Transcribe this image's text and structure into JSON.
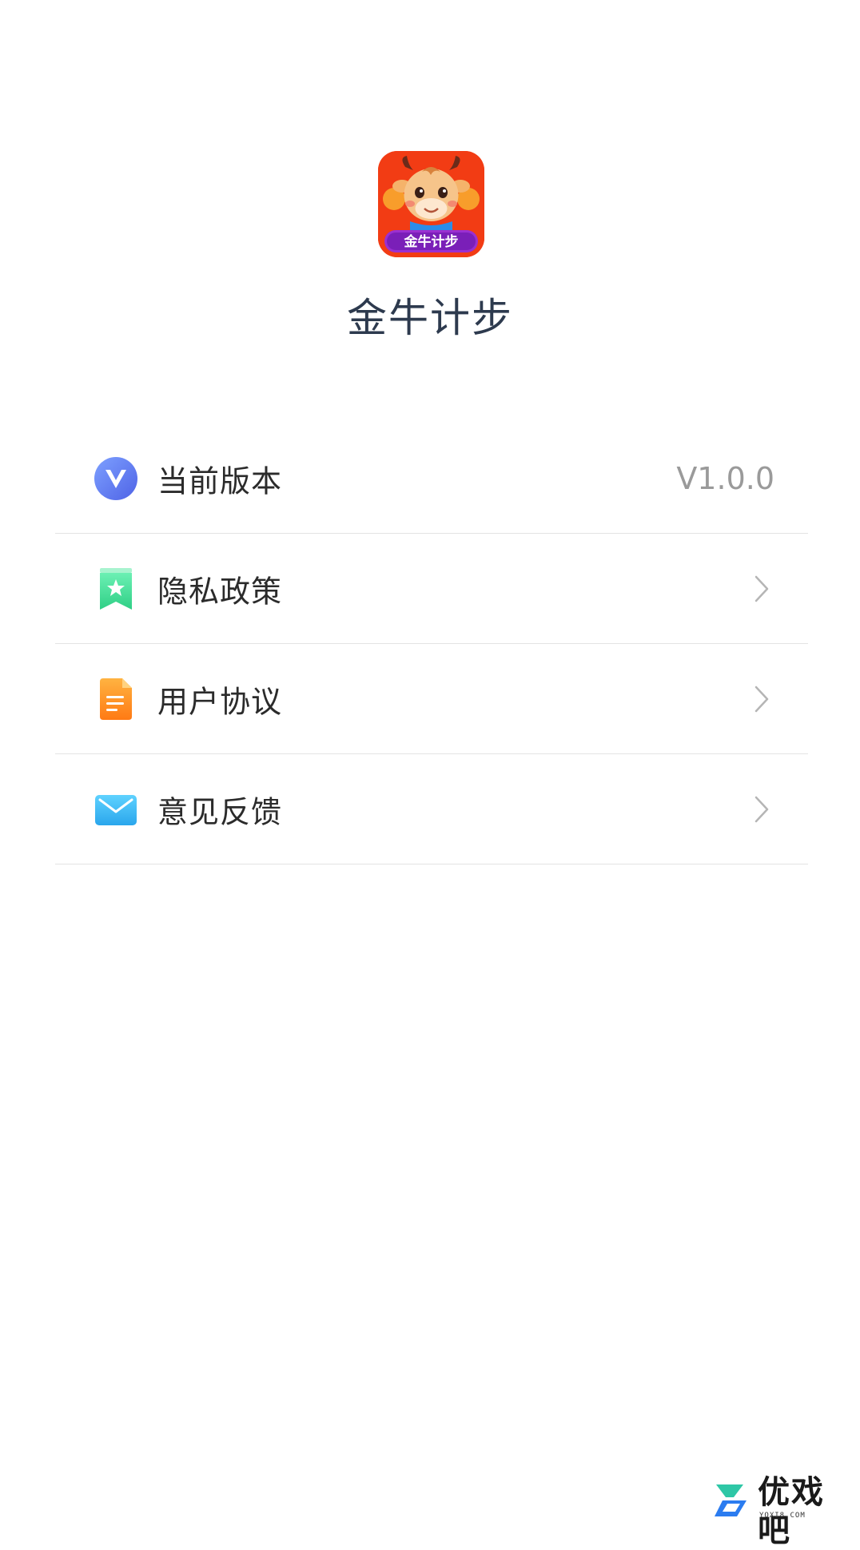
{
  "app": {
    "name": "金牛计步",
    "icon_banner_text": "金牛计步"
  },
  "settings": {
    "items": [
      {
        "label": "当前版本",
        "value": "V1.0.0",
        "icon": "version-icon"
      },
      {
        "label": "隐私政策",
        "icon": "privacy-bookmark-icon"
      },
      {
        "label": "用户协议",
        "icon": "document-icon"
      },
      {
        "label": "意见反馈",
        "icon": "mail-icon"
      }
    ]
  },
  "watermark": {
    "text": "优戏吧",
    "subtext": "YOXI8.COM"
  },
  "colors": {
    "title": "#2d3a4e",
    "label": "#2b2b2b",
    "value": "#9a9a9a",
    "divider": "#e3e3e3",
    "version_icon": "#5a7af0",
    "privacy_icon": "#3ddc97",
    "document_icon": "#ff8a1e",
    "mail_icon": "#3bb6f5"
  }
}
